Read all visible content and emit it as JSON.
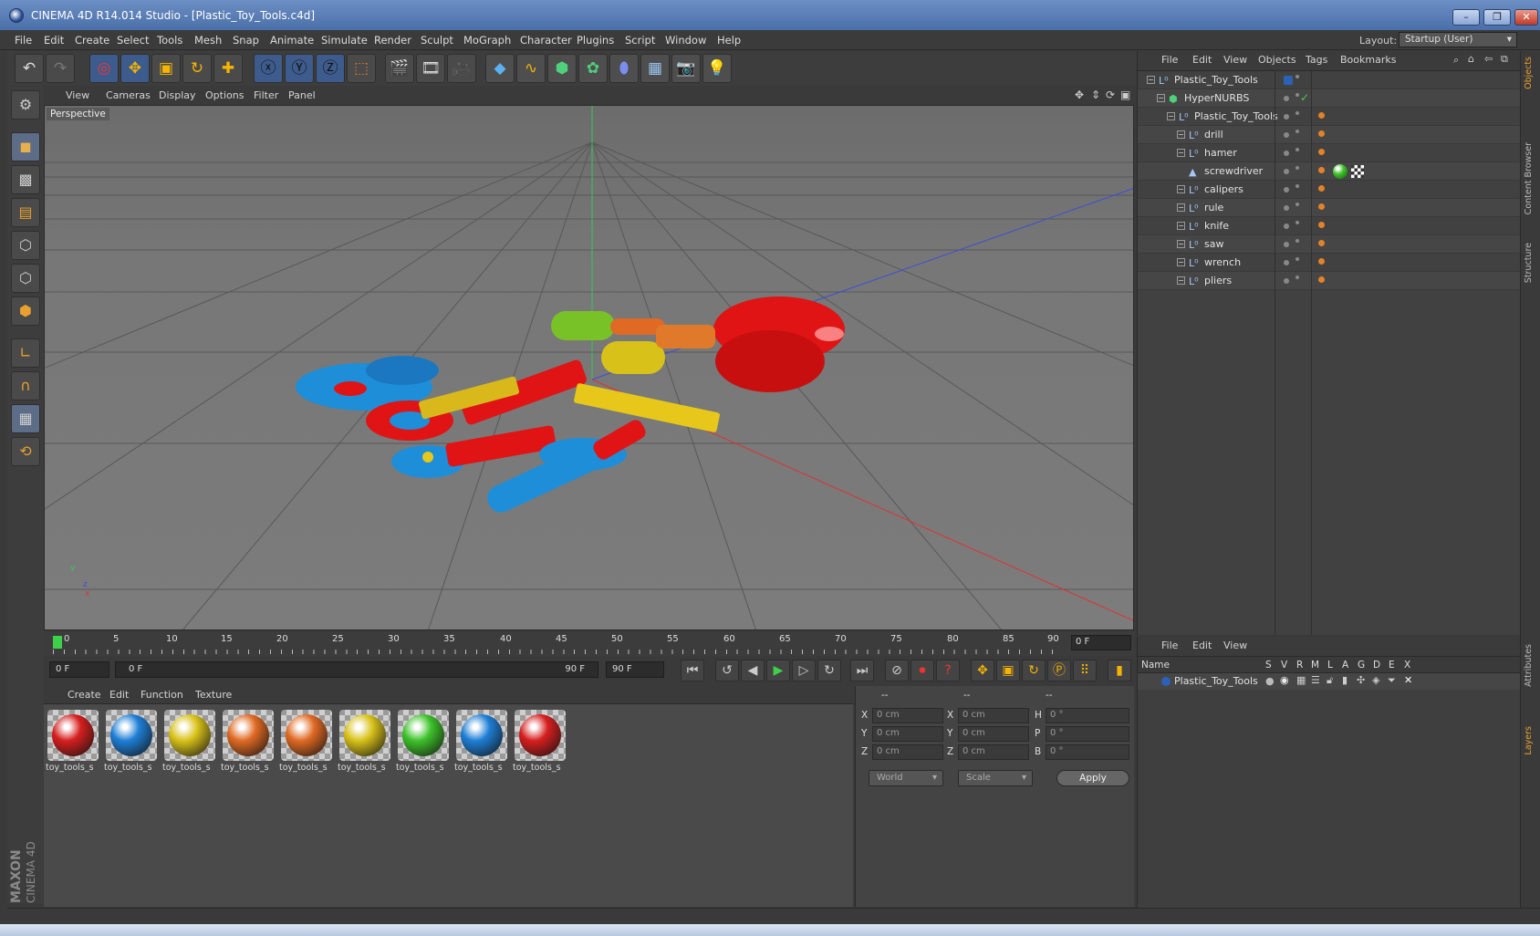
{
  "window": {
    "title": "CINEMA 4D R14.014 Studio - [Plastic_Toy_Tools.c4d]",
    "minimize": "–",
    "restore": "❐",
    "close": "✕"
  },
  "menubar": {
    "items": [
      "File",
      "Edit",
      "Create",
      "Select",
      "Tools",
      "Mesh",
      "Snap",
      "Animate",
      "Simulate",
      "Render",
      "Sculpt",
      "MoGraph",
      "Character",
      "Plugins",
      "Script",
      "Window",
      "Help"
    ],
    "layout_label": "Layout:",
    "layout_value": "Startup (User)"
  },
  "viewport": {
    "menu": [
      "View",
      "Cameras",
      "Display",
      "Options",
      "Filter",
      "Panel"
    ],
    "view_label": "Perspective"
  },
  "timeline": {
    "ticks": [
      "0",
      "5",
      "10",
      "15",
      "20",
      "25",
      "30",
      "35",
      "40",
      "45",
      "50",
      "55",
      "60",
      "65",
      "70",
      "75",
      "80",
      "85",
      "90"
    ],
    "end_frame": "0 F"
  },
  "transport": {
    "current_frame": "0 F",
    "range_start": "0 F",
    "range_end": "90 F",
    "max_frame": "90 F"
  },
  "materials": {
    "menu": [
      "Create",
      "Edit",
      "Function",
      "Texture"
    ],
    "items": [
      {
        "name": "toy_tools_s",
        "color": "#d61f1f"
      },
      {
        "name": "toy_tools_s",
        "color": "#1f7fd6"
      },
      {
        "name": "toy_tools_s",
        "color": "#d8c21a"
      },
      {
        "name": "toy_tools_s",
        "color": "#e06a24"
      },
      {
        "name": "toy_tools_s",
        "color": "#e06a24"
      },
      {
        "name": "toy_tools_s",
        "color": "#d8c21a"
      },
      {
        "name": "toy_tools_s",
        "color": "#3ec22a"
      },
      {
        "name": "toy_tools_s",
        "color": "#1f7fd6"
      },
      {
        "name": "toy_tools_s",
        "color": "#d61f1f"
      }
    ]
  },
  "coordinates": {
    "header": [
      "--",
      "--",
      "--"
    ],
    "rows": [
      {
        "a": "X",
        "av": "0 cm",
        "b": "X",
        "bv": "0 cm",
        "c": "H",
        "cv": "0 °"
      },
      {
        "a": "Y",
        "av": "0 cm",
        "b": "Y",
        "bv": "0 cm",
        "c": "P",
        "cv": "0 °"
      },
      {
        "a": "Z",
        "av": "0 cm",
        "b": "Z",
        "bv": "0 cm",
        "c": "B",
        "cv": "0 °"
      }
    ],
    "mode_world": "World",
    "mode_scale": "Scale",
    "apply": "Apply"
  },
  "objects": {
    "menu": [
      "File",
      "Edit",
      "View",
      "Objects",
      "Tags",
      "Bookmarks"
    ],
    "rows": [
      {
        "name": "Plastic_Toy_Tools",
        "indent": 0,
        "icon": "null-icon"
      },
      {
        "name": "HyperNURBS",
        "indent": 1,
        "icon": "hypernurbs-icon"
      },
      {
        "name": "Plastic_Toy_Tools",
        "indent": 2,
        "icon": "null-icon"
      },
      {
        "name": "drill",
        "indent": 3,
        "icon": "null-icon"
      },
      {
        "name": "hamer",
        "indent": 3,
        "icon": "null-icon"
      },
      {
        "name": "screwdriver",
        "indent": 3,
        "icon": "polygon-icon"
      },
      {
        "name": "calipers",
        "indent": 3,
        "icon": "null-icon"
      },
      {
        "name": "rule",
        "indent": 3,
        "icon": "null-icon"
      },
      {
        "name": "knife",
        "indent": 3,
        "icon": "null-icon"
      },
      {
        "name": "saw",
        "indent": 3,
        "icon": "null-icon"
      },
      {
        "name": "wrench",
        "indent": 3,
        "icon": "null-icon"
      },
      {
        "name": "pliers",
        "indent": 3,
        "icon": "null-icon"
      }
    ]
  },
  "layers": {
    "menu": [
      "File",
      "Edit",
      "View"
    ],
    "columns": [
      "Name",
      "S",
      "V",
      "R",
      "M",
      "L",
      "A",
      "G",
      "D",
      "E",
      "X"
    ],
    "row_name": "Plastic_Toy_Tools"
  },
  "right_tabs": [
    "Objects",
    "Content Browser",
    "Structure",
    "Attributes",
    "Layers"
  ],
  "logo": {
    "line1": "MAXON",
    "line2": "CINEMA 4D"
  }
}
